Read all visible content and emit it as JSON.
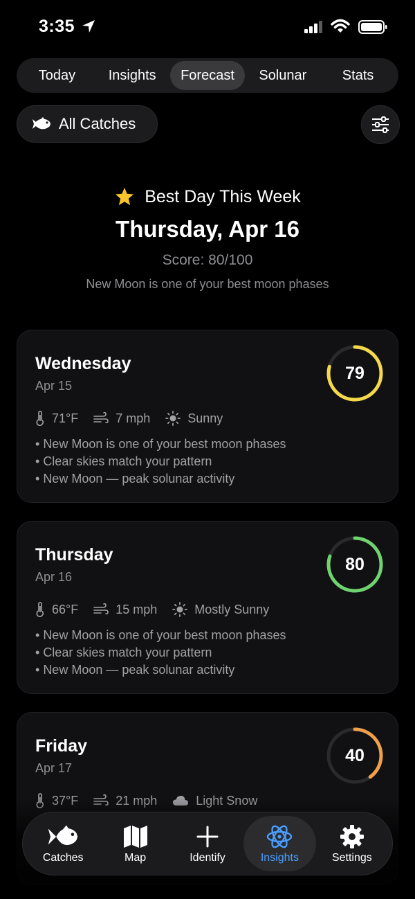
{
  "status_bar": {
    "time": "3:35"
  },
  "tabs": [
    {
      "label": "Today",
      "active": false
    },
    {
      "label": "Insights",
      "active": false
    },
    {
      "label": "Forecast",
      "active": true
    },
    {
      "label": "Solunar",
      "active": false
    },
    {
      "label": "Stats",
      "active": false
    }
  ],
  "filter": {
    "label": "All Catches",
    "icon": "fish-icon",
    "settings_icon": "sliders-icon"
  },
  "best_day": {
    "heading": "Best Day This Week",
    "date": "Thursday, Apr 16",
    "score": "Score: 80/100",
    "note": "New Moon is one of your best moon phases"
  },
  "days": [
    {
      "day": "Wednesday",
      "date": "Apr 15",
      "score": 79,
      "score_fraction": 0.79,
      "color": "#f5d94a",
      "temp": "71°F",
      "wind": "7 mph",
      "sky": "Sunny",
      "sky_icon": "sun-icon",
      "notes": [
        "New Moon is one of your best moon phases",
        "Clear skies match your pattern",
        "New Moon — peak solunar activity"
      ]
    },
    {
      "day": "Thursday",
      "date": "Apr 16",
      "score": 80,
      "score_fraction": 0.8,
      "color": "#6fd46f",
      "temp": "66°F",
      "wind": "15 mph",
      "sky": "Mostly Sunny",
      "sky_icon": "sun-icon",
      "notes": [
        "New Moon is one of your best moon phases",
        "Clear skies match your pattern",
        "New Moon — peak solunar activity"
      ]
    },
    {
      "day": "Friday",
      "date": "Apr 17",
      "score": 40,
      "score_fraction": 0.4,
      "color": "#f0a04b",
      "temp": "37°F",
      "wind": "21 mph",
      "sky": "Light Snow",
      "sky_icon": "cloud-icon",
      "notes": []
    }
  ],
  "nav": [
    {
      "label": "Catches",
      "icon": "fish-icon",
      "active": false
    },
    {
      "label": "Map",
      "icon": "map-icon",
      "active": false
    },
    {
      "label": "Identify",
      "icon": "plus-icon",
      "active": false
    },
    {
      "label": "Insights",
      "icon": "atom-icon",
      "active": true
    },
    {
      "label": "Settings",
      "icon": "gear-icon",
      "active": false
    }
  ]
}
